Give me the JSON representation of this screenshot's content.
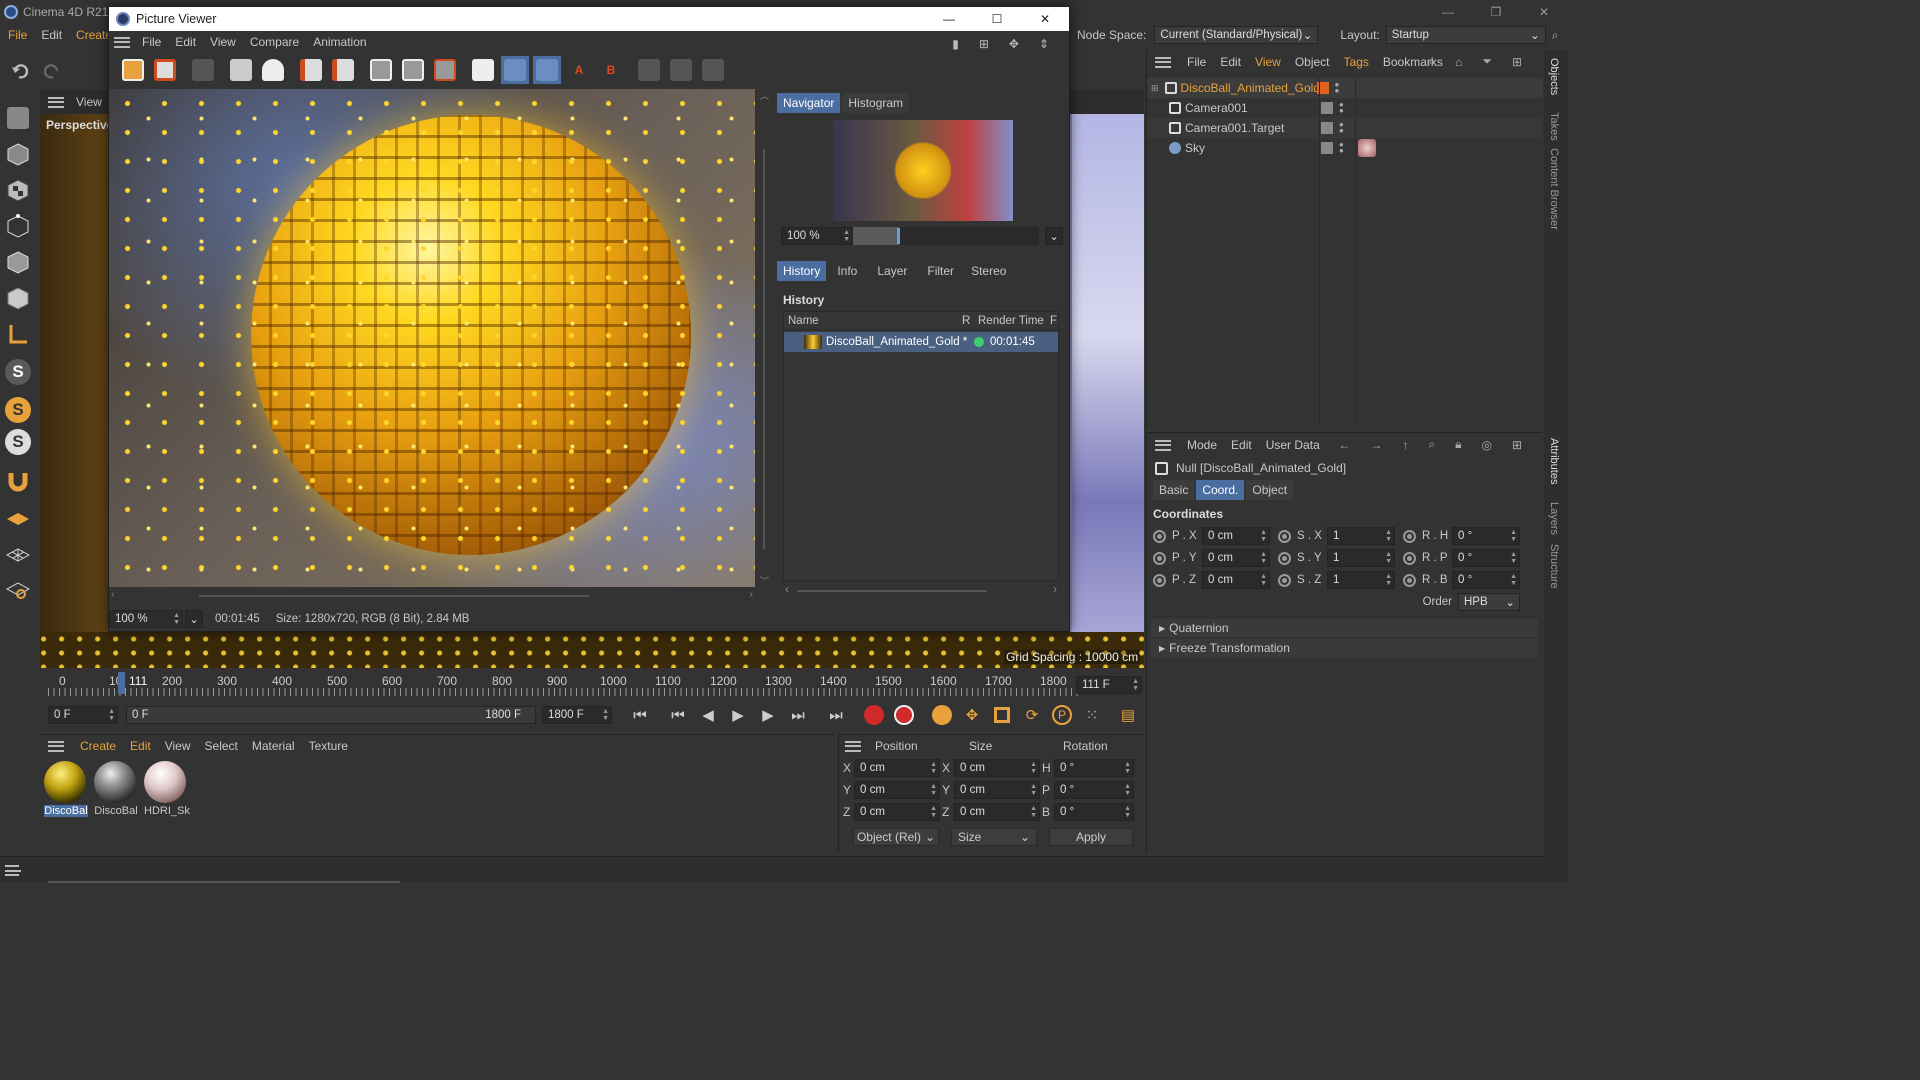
{
  "app": {
    "title": "Cinema 4D R21",
    "menu": [
      "File",
      "Edit",
      "Create"
    ],
    "win_controls": [
      "—",
      "❐",
      "✕"
    ]
  },
  "topright": {
    "node_space_label": "Node Space:",
    "node_space_value": "Current (Standard/Physical)",
    "layout_label": "Layout:",
    "layout_value": "Startup"
  },
  "viewport": {
    "menu_view": "View",
    "label": "Perspective",
    "grid_spacing": "Grid Spacing : 10000 cm"
  },
  "picture_viewer": {
    "title": "Picture Viewer",
    "menu": [
      "File",
      "Edit",
      "View",
      "Compare",
      "Animation"
    ],
    "zoom": "100 %",
    "time": "00:01:45",
    "size_info": "Size: 1280x720, RGB (8 Bit), 2.84 MB",
    "nav_tabs": [
      "Navigator",
      "Histogram"
    ],
    "nav_zoom": "100 %",
    "tabs": [
      "History",
      "Info",
      "Layer",
      "Filter",
      "Stereo"
    ],
    "history_heading": "History",
    "history_cols": [
      "Name",
      "R",
      "Render Time",
      "F"
    ],
    "history_row": {
      "name": "DiscoBall_Animated_Gold *",
      "time": "00:01:45"
    }
  },
  "object_manager": {
    "menu": [
      "File",
      "Edit",
      "View",
      "Object",
      "Tags",
      "Bookmarks"
    ],
    "objects": [
      {
        "name": "DiscoBall_Animated_Gold",
        "active": true
      },
      {
        "name": "Camera001",
        "active": false
      },
      {
        "name": "Camera001.Target",
        "active": false
      },
      {
        "name": "Sky",
        "active": false
      }
    ]
  },
  "side_tabs_top": [
    "Objects",
    "Takes",
    "Content Browser"
  ],
  "side_tabs_bottom": [
    "Attributes",
    "Layers",
    "Structure"
  ],
  "attributes": {
    "menu": [
      "Mode",
      "Edit",
      "User Data"
    ],
    "object_title": "Null [DiscoBall_Animated_Gold]",
    "tabs": [
      "Basic",
      "Coord.",
      "Object"
    ],
    "section": "Coordinates",
    "rows": [
      {
        "p_label": "P . X",
        "p": "0 cm",
        "s_label": "S . X",
        "s": "1",
        "r_label": "R . H",
        "r": "0 °"
      },
      {
        "p_label": "P . Y",
        "p": "0 cm",
        "s_label": "S . Y",
        "s": "1",
        "r_label": "R . P",
        "r": "0 °"
      },
      {
        "p_label": "P . Z",
        "p": "0 cm",
        "s_label": "S . Z",
        "s": "1",
        "r_label": "R . B",
        "r": "0 °"
      }
    ],
    "order_label": "Order",
    "order_value": "HPB",
    "groups": [
      "Quaternion",
      "Freeze Transformation"
    ]
  },
  "timeline": {
    "ticks": [
      "0",
      "10",
      "111",
      "200",
      "300",
      "400",
      "500",
      "600",
      "700",
      "800",
      "900",
      "1000",
      "1100",
      "1200",
      "1300",
      "1400",
      "1500",
      "1600",
      "1700",
      "1800"
    ],
    "current_frame": "111 F",
    "start": "0 F",
    "range_start": "0 F",
    "range_end": "1800 F",
    "end": "1800 F"
  },
  "material_manager": {
    "menu": [
      "Create",
      "Edit",
      "View",
      "Select",
      "Material",
      "Texture"
    ],
    "materials": [
      "DiscoBal",
      "DiscoBal",
      "HDRI_Sk"
    ]
  },
  "coord_manager": {
    "headers": [
      "Position",
      "Size",
      "Rotation"
    ],
    "rows": [
      {
        "axis": "X",
        "pos": "0 cm",
        "size_axis": "X",
        "size": "0 cm",
        "rot_axis": "H",
        "rot": "0 °"
      },
      {
        "axis": "Y",
        "pos": "0 cm",
        "size_axis": "Y",
        "size": "0 cm",
        "rot_axis": "P",
        "rot": "0 °"
      },
      {
        "axis": "Z",
        "pos": "0 cm",
        "size_axis": "Z",
        "size": "0 cm",
        "rot_axis": "B",
        "rot": "0 °"
      }
    ],
    "mode": "Object (Rel)",
    "size_mode": "Size",
    "apply": "Apply"
  }
}
